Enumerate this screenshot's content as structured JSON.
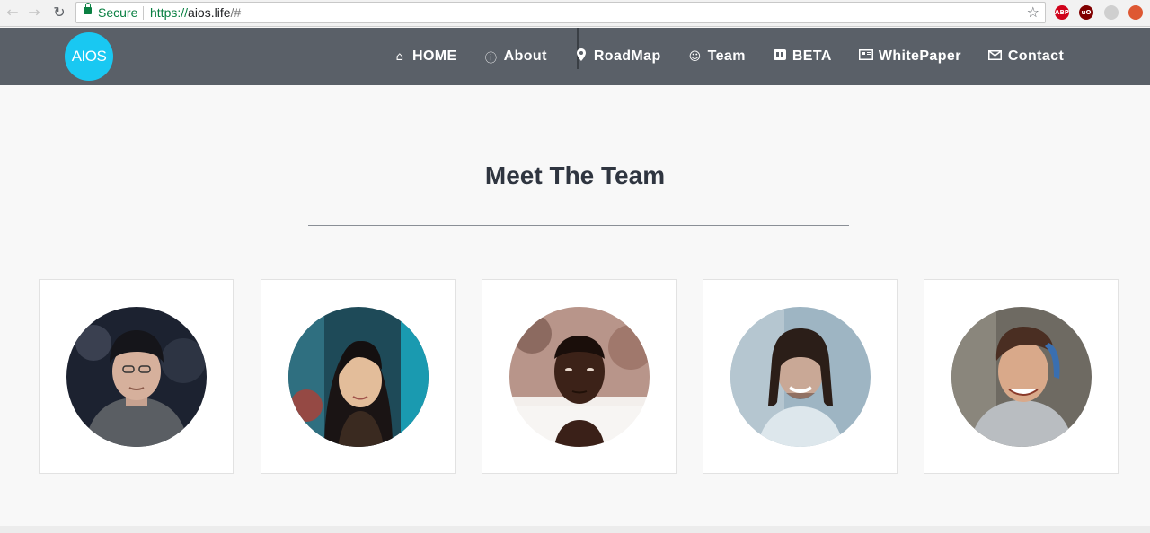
{
  "browser": {
    "secure_label": "Secure",
    "url_scheme": "https://",
    "url_host": "aios.life",
    "url_path": "/#",
    "back_icon": "arrow-left-icon",
    "forward_icon": "arrow-right-icon",
    "reload_icon": "reload-icon",
    "bookmark_icon": "star-icon",
    "extensions": [
      {
        "name": "adblock-plus-icon",
        "label": "ABP",
        "color": "#d0021b"
      },
      {
        "name": "ublock-icon",
        "label": "uO",
        "color": "#800000"
      },
      {
        "name": "gray-extension-icon",
        "label": "",
        "color": "#cfcfcf"
      },
      {
        "name": "duckduckgo-icon",
        "label": "",
        "color": "#de5833"
      }
    ]
  },
  "header": {
    "logo_text": "AIOS",
    "logo_color": "#19c8f2",
    "bg_color": "#5a6068",
    "menu": [
      {
        "label": "HOME",
        "icon": "home-icon"
      },
      {
        "label": "About",
        "icon": "info-icon"
      },
      {
        "label": "RoadMap",
        "icon": "map-marker-icon"
      },
      {
        "label": "Team",
        "icon": "smile-icon"
      },
      {
        "label": "BETA",
        "icon": "beta-badge-icon"
      },
      {
        "label": "WhitePaper",
        "icon": "newspaper-icon"
      },
      {
        "label": "Contact",
        "icon": "envelope-icon"
      }
    ]
  },
  "team": {
    "title": "Meet The Team",
    "members": [
      {
        "photo": "team-member-1-photo"
      },
      {
        "photo": "team-member-2-photo"
      },
      {
        "photo": "team-member-3-photo"
      },
      {
        "photo": "team-member-4-photo"
      },
      {
        "photo": "team-member-5-photo"
      }
    ]
  }
}
